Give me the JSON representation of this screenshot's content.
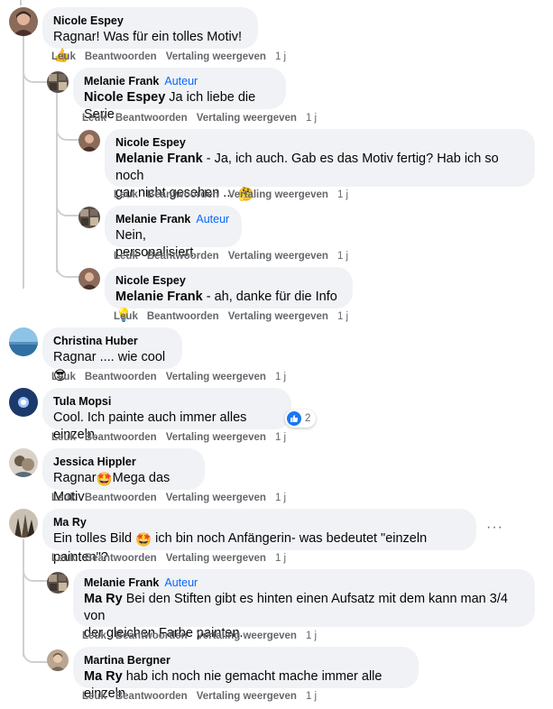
{
  "actions": {
    "like": "Leuk",
    "reply": "Beantwoorden",
    "translate": "Vertaling weergeven"
  },
  "author_badge": "Auteur",
  "comments": [
    {
      "name": "Nicole Espey",
      "text": "Ragnar! Was für ein tolles Motiv!",
      "emoji": "👍",
      "time": "1 j"
    },
    {
      "name": "Melanie Frank",
      "mention": "Nicole Espey",
      "text": " Ja ich liebe die Serie",
      "time": "1 j"
    },
    {
      "name": "Nicole Espey",
      "mention": "Melanie Frank",
      "text_line1": " - Ja, ich auch. Gab es das Motiv fertig? Hab ich so noch",
      "text_line2": "gar nicht gesehen ...",
      "emoji": "🤔",
      "time": "1 j"
    },
    {
      "name": "Melanie Frank",
      "text": "Nein, personalisiert.",
      "time": "1 j"
    },
    {
      "name": "Nicole Espey",
      "mention": "Melanie Frank",
      "text": " - ah, danke für die Info",
      "emoji": "💡",
      "time": "1 j"
    },
    {
      "name": "Christina Huber",
      "text": "Ragnar .... wie cool",
      "emoji": "😎",
      "time": "1 j"
    },
    {
      "name": "Tula Mopsi",
      "text": "Cool. Ich painte auch immer alles einzeln.",
      "reaction_count": "2",
      "time": "1 j"
    },
    {
      "name": "Jessica Hippler",
      "text_before": "Ragnar",
      "emoji": "🤩",
      "text_after": "Mega das Motiv",
      "time": "1 j"
    },
    {
      "name": "Ma Ry",
      "text_before": "Ein tolles Bild",
      "emoji": "🤩",
      "text_after": " ich bin noch Anfängerin- was bedeutet \"einzeln painten\"?",
      "more": "···",
      "time": "1 j"
    },
    {
      "name": "Melanie Frank",
      "mention": "Ma Ry",
      "text_line1": " Bei den Stiften gibt es hinten einen Aufsatz mit dem kann man 3/4 von",
      "text_line2": "der gleichen Farbe painten.",
      "time": "1 j"
    },
    {
      "name": "Martina Bergner",
      "mention": "Ma Ry",
      "text": " hab ich noch nie gemacht mache immer alle einzeln",
      "time": "1 j"
    }
  ],
  "colors": {
    "bubble": "#f0f2f5",
    "author": "#0866ff",
    "meta": "#65676b",
    "thread": "#ced0d4"
  }
}
